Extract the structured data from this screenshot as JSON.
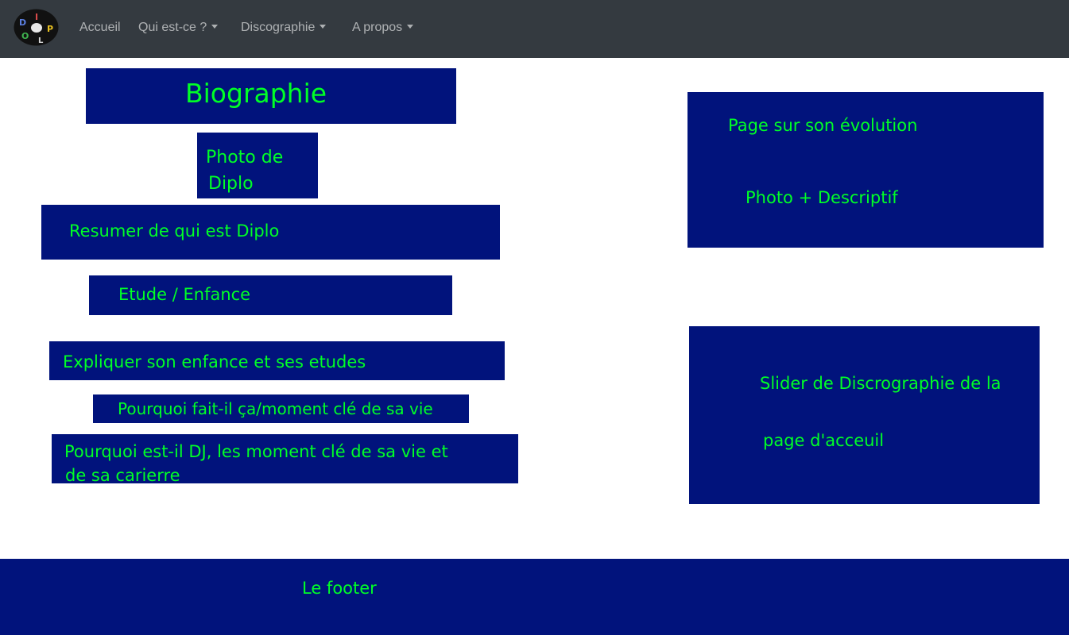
{
  "navbar": {
    "logo_letters": [
      "D",
      "I",
      "P",
      "L",
      "O"
    ],
    "items": [
      {
        "label": "Accueil",
        "dropdown": false
      },
      {
        "label": "Qui est-ce ?",
        "dropdown": true
      },
      {
        "label": "Discographie",
        "dropdown": true
      },
      {
        "label": "A propos",
        "dropdown": true
      }
    ]
  },
  "left_column": {
    "title": "Biographie",
    "photo_line1": "Photo de",
    "photo_line2": "Diplo",
    "summary": "Resumer de qui est Diplo",
    "studies_heading": "Etude / Enfance",
    "studies_text": "Expliquer son enfance et ses etudes",
    "why_heading": "Pourquoi fait-il ça/moment clé de sa vie",
    "why_line1": "Pourquoi est-il DJ, les moment clé de sa vie et",
    "why_line2": "de sa carierre"
  },
  "right_column": {
    "evolution_title": "Page sur son évolution",
    "evolution_content": "Photo + Descriptif",
    "slider_line1": "Slider de Discrographie de la",
    "slider_line2": "page d'acceuil"
  },
  "footer": {
    "text": "Le footer"
  },
  "colors": {
    "navbar_bg": "#343a40",
    "block_bg": "#01137c",
    "block_text": "#00ff26"
  }
}
